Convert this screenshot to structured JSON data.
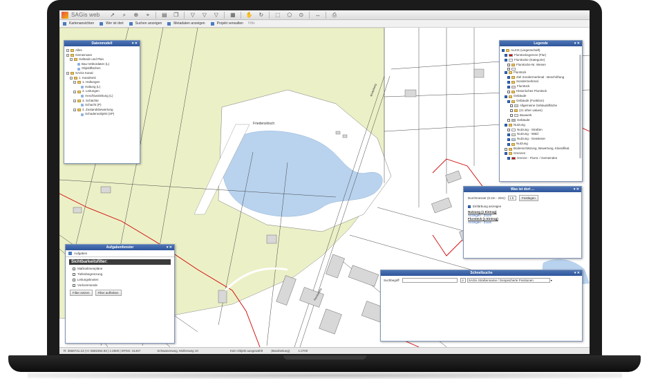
{
  "app": {
    "title": "SAGis web",
    "toolbar_icons": [
      "cursor-icon",
      "zoom-box-icon",
      "zoom-in-icon",
      "measure-icon",
      "print-icon",
      "copy-icon",
      "filter-icon",
      "filter-add-icon",
      "filter-remove-icon",
      "grid-icon",
      "pan-hand-icon",
      "refresh-icon",
      "select-rect-icon",
      "select-poly-icon",
      "select-point-icon",
      "arrows-icon",
      "printer-icon"
    ]
  },
  "menubar": {
    "items": [
      "Kartenansichten",
      "Wer ist dort",
      "Suchen anzeigen",
      "Metadaten anzeigen",
      "Projekt verwalten",
      "Hilfe"
    ]
  },
  "statusbar": {
    "coords": "R: 3566741.13  |  H: 5681964.93  |  1:2500  |  EPSG: 31467",
    "location": "Schwanenweg, Mollenweg 10",
    "status": "Kein Objekt ausgewählt",
    "mode": "(Bearbeitung)",
    "scale": "1:2700"
  },
  "datenmodell": {
    "title": "Datenmodell",
    "items": [
      {
        "label": "Alles",
        "level": 0,
        "kind": "folder"
      },
      {
        "label": "Gemeinsam",
        "level": 0,
        "kind": "folder"
      },
      {
        "label": "Gelände und Plan",
        "level": 1,
        "kind": "folder"
      },
      {
        "label": "Bau-Vektordaten (L)",
        "level": 2,
        "kind": "leaf"
      },
      {
        "label": "Objektflächen",
        "level": 2,
        "kind": "leaf"
      },
      {
        "label": "SAGis Kanal",
        "level": 0,
        "kind": "folder"
      },
      {
        "label": "1. Kanalnetz",
        "level": 1,
        "kind": "folder"
      },
      {
        "label": "1. Haltungen",
        "level": 2,
        "kind": "folder"
      },
      {
        "label": "Haltung (L)",
        "level": 3,
        "kind": "leaf"
      },
      {
        "label": "2. Leitungen",
        "level": 2,
        "kind": "folder"
      },
      {
        "label": "Anschlussleitung (L)",
        "level": 3,
        "kind": "leaf"
      },
      {
        "label": "3. Schächte",
        "level": 2,
        "kind": "folder"
      },
      {
        "label": "Schacht (P)",
        "level": 3,
        "kind": "leaf"
      },
      {
        "label": "4. Zustandsbewertung",
        "level": 2,
        "kind": "folder"
      },
      {
        "label": "Schadensobjekt (SP)",
        "level": 3,
        "kind": "leaf"
      }
    ]
  },
  "legende": {
    "title": "Legende",
    "items": [
      {
        "label": "ALKIS (Liegenschaft)",
        "level": 0,
        "checked": true,
        "swatch": ""
      },
      {
        "label": "Flurstücksgrenze (Flur)",
        "level": 1,
        "checked": true,
        "swatch": "#d00000"
      },
      {
        "label": "Flurstücke (Kategorie)",
        "level": 1,
        "checked": true,
        "swatch": "#ffffff"
      },
      {
        "label": "Flurstücks-Nr. Wesen",
        "level": 2,
        "checked": false,
        "swatch": ""
      },
      {
        "label": "",
        "level": 2,
        "checked": false,
        "swatch": "#ffffff"
      },
      {
        "label": "Flurstück",
        "level": 1,
        "checked": true,
        "swatch": ""
      },
      {
        "label": "Ziel Sondermerkmal - Beschriftung",
        "level": 2,
        "checked": true,
        "swatch": ""
      },
      {
        "label": "Sondermerkmal",
        "level": 2,
        "checked": true,
        "swatch": ""
      },
      {
        "label": "Flurstück",
        "level": 2,
        "checked": true,
        "swatch": "#f2d9d9"
      },
      {
        "label": "Historisches Flurstück",
        "level": 2,
        "checked": false,
        "swatch": ""
      },
      {
        "label": "Gebäude",
        "level": 1,
        "checked": true,
        "swatch": ""
      },
      {
        "label": "Gebäude (Funktion)",
        "level": 2,
        "checked": true,
        "swatch": ""
      },
      {
        "label": "Allgemeine Gebäudefläche",
        "level": 3,
        "checked": false,
        "swatch": "#d9d9d9"
      },
      {
        "label": "(21 other values)",
        "level": 3,
        "checked": false,
        "swatch": ""
      },
      {
        "label": "Bauwerk",
        "level": 3,
        "checked": false,
        "swatch": "#eeeeee"
      },
      {
        "label": "Gebäude",
        "level": 2,
        "checked": false,
        "swatch": "#bbbbbb"
      },
      {
        "label": "Nutzung",
        "level": 1,
        "checked": true,
        "swatch": ""
      },
      {
        "label": "Nutzung - Straßen",
        "level": 2,
        "checked": false,
        "swatch": "#ffffff"
      },
      {
        "label": "Nutzung - Wald",
        "level": 2,
        "checked": true,
        "swatch": "#dceccd"
      },
      {
        "label": "Nutzung - Gewässer",
        "level": 2,
        "checked": true,
        "swatch": "#b9d3ee"
      },
      {
        "label": "Nutzung",
        "level": 2,
        "checked": true,
        "swatch": ""
      },
      {
        "label": "Bodenschätzung, Bewertung, Klassifikat.",
        "level": 1,
        "checked": false,
        "swatch": ""
      },
      {
        "label": "Grenzen",
        "level": 1,
        "checked": true,
        "swatch": ""
      },
      {
        "label": "Grenze - Flurst. / Gemeinden",
        "level": 2,
        "checked": true,
        "swatch": "#d00000"
      }
    ]
  },
  "wasistdort": {
    "title": "Was ist dort ...",
    "radius_label": "Durchmesser (0.2m - 20m):",
    "radius_value": "1.5",
    "refresh_label": "Festlegen",
    "highlight_label": "Einfärbung anzeigen",
    "results": [
      {
        "heading": "Nutzung (1 Eintrag)",
        "link": "Anzeigen - Zoom"
      },
      {
        "heading": "Flurstück (1 Eintrag)",
        "link": "Anzeigen - Zoom"
      }
    ]
  },
  "aufgabenfenster": {
    "title": "Aufgabenfenster",
    "toolbar_label": "Aufgaben",
    "filter_title": "Sichtbarkeitsfilter:",
    "filters": [
      "Maßnahmenpläne",
      "Tiefenbegrenzung",
      "Leitungsknoten",
      "Vorkommende"
    ],
    "apply_label": "Filter setzen",
    "clear_label": "Filter aufheben"
  },
  "schnellsuche": {
    "title": "Schnellsuche",
    "search_label": "Suchbegriff",
    "search_value": "",
    "scope_value": "SAGis Straßenname / Gespeicherte Positionen"
  },
  "map": {
    "place_label": "Friedenslösch",
    "road_label": "Winkelweg",
    "road_label2": "Nordstraße",
    "colors": {
      "field": "#ecf0c7",
      "water": "#b9d3ee",
      "parcel_line": "#444444",
      "boundary": "#d00000",
      "building": "#d8d8d8"
    }
  }
}
